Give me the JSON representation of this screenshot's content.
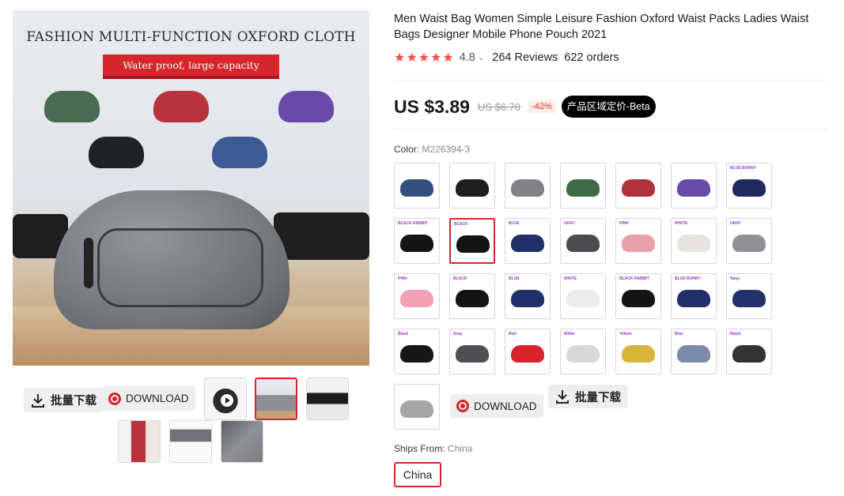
{
  "gallery": {
    "hero_title": "FASHION MULTI-FUNCTION OXFORD CLOTH",
    "hero_banner": "Water proof,  large capacity",
    "mini_bag_colors": [
      "#4a6b52",
      "#b8343d",
      "#6a4aa8",
      "#1f2326",
      "#3d5a94"
    ],
    "bulk_download_label": "批量下载",
    "download_label": "DOWNLOAD",
    "thumbnails": [
      {
        "name": "video",
        "color": "#2a2a2a"
      },
      {
        "name": "cover",
        "color": "#8d8f93"
      },
      {
        "name": "model-front",
        "color": "#1e1e1e"
      },
      {
        "name": "model-side",
        "color": "#b8343d"
      },
      {
        "name": "contents",
        "color": "#6f7276"
      },
      {
        "name": "detail",
        "color": "#7d7f83"
      }
    ]
  },
  "product": {
    "title": "Men Waist Bag Women Simple Leisure Fashion Oxford Waist Packs Ladies Waist Bags Designer Mobile Phone Pouch 2021",
    "stars": "★★★★★",
    "rating": "4.8",
    "reviews": "264 Reviews",
    "orders": "622 orders",
    "price": "US $3.89",
    "old_price": "US $6.70",
    "discount": "-42%",
    "beta_badge": "产品区域定价-Beta",
    "color_label": "Color:",
    "color_value": "M226394-3",
    "swatches": [
      {
        "tag": "",
        "color": "#34507f",
        "selected": false
      },
      {
        "tag": "",
        "color": "#1e1e1e",
        "selected": false
      },
      {
        "tag": "",
        "color": "#808285",
        "selected": false
      },
      {
        "tag": "",
        "color": "#3e6b48",
        "selected": false
      },
      {
        "tag": "",
        "color": "#b0313a",
        "selected": false
      },
      {
        "tag": "",
        "color": "#6a4aa8",
        "selected": false
      },
      {
        "tag": "BLUE BUNNY",
        "color": "#1f2b5e",
        "selected": false
      },
      {
        "tag": "BLACK RABBIT",
        "color": "#141414",
        "selected": false
      },
      {
        "tag": "BLACK",
        "color": "#141414",
        "selected": true
      },
      {
        "tag": "BLUE",
        "color": "#22306a",
        "selected": false
      },
      {
        "tag": "GRAY",
        "color": "#4a4c50",
        "selected": false
      },
      {
        "tag": "PINK",
        "color": "#e8a0a8",
        "selected": false
      },
      {
        "tag": "WHITE",
        "color": "#e6e4de",
        "selected": false
      },
      {
        "tag": "GRAY",
        "color": "#8f9195",
        "selected": false
      },
      {
        "tag": "PINK",
        "color": "#f2a2b4",
        "selected": false
      },
      {
        "tag": "BLACK",
        "color": "#141414",
        "selected": false
      },
      {
        "tag": "BLUE",
        "color": "#22306a",
        "selected": false
      },
      {
        "tag": "WHITE",
        "color": "#ececec",
        "selected": false
      },
      {
        "tag": "BLACK RABBIT",
        "color": "#141414",
        "selected": false
      },
      {
        "tag": "BLUE BUNNY",
        "color": "#22306a",
        "selected": false
      },
      {
        "tag": "Navy",
        "color": "#24306a",
        "selected": false
      },
      {
        "tag": "Black",
        "color": "#161616",
        "selected": false
      },
      {
        "tag": "Gray",
        "color": "#4d4f55",
        "selected": false
      },
      {
        "tag": "Red",
        "color": "#d8242e",
        "selected": false
      },
      {
        "tag": "White",
        "color": "#d9d9d9",
        "selected": false
      },
      {
        "tag": "Yellow",
        "color": "#d9b43a",
        "selected": false
      },
      {
        "tag": "Blue",
        "color": "#7c8aa8",
        "selected": false
      },
      {
        "tag": "Black",
        "color": "#333333",
        "selected": false
      },
      {
        "tag": "",
        "color": "#a5a5a5",
        "selected": false
      }
    ],
    "swatch_download_label": "DOWNLOAD",
    "swatch_bulk_label": "批量下载",
    "ships_label": "Ships From:",
    "ships_value": "China",
    "ship_option": "China"
  }
}
